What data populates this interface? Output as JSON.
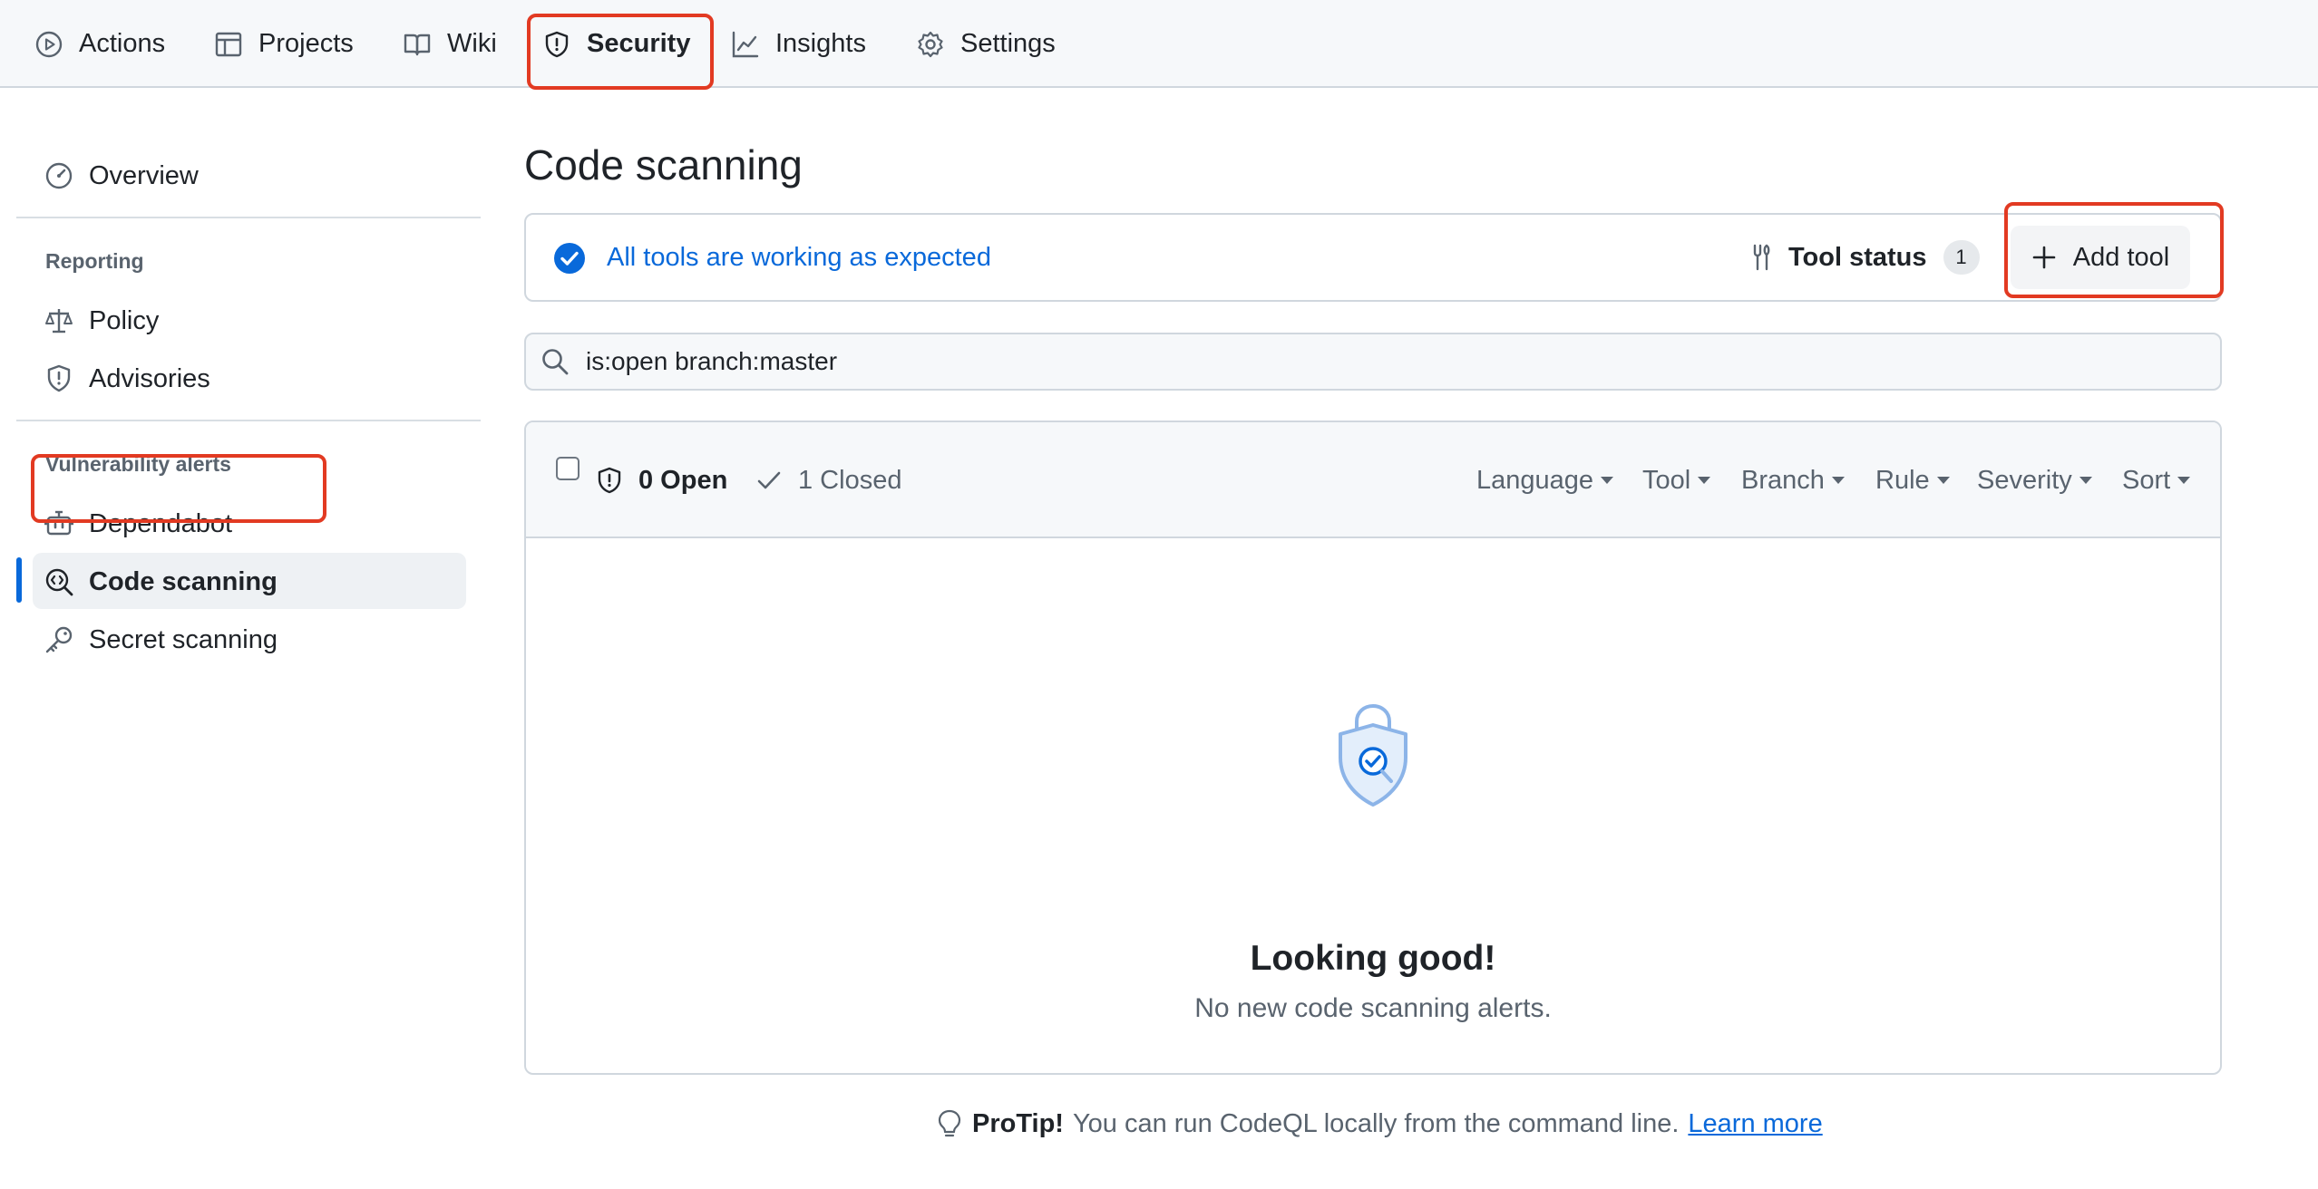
{
  "nav": {
    "items": [
      {
        "label": "Actions",
        "icon": "play-icon"
      },
      {
        "label": "Projects",
        "icon": "table-icon"
      },
      {
        "label": "Wiki",
        "icon": "book-icon"
      },
      {
        "label": "Security",
        "icon": "shield-icon",
        "selected": true
      },
      {
        "label": "Insights",
        "icon": "graph-icon"
      },
      {
        "label": "Settings",
        "icon": "gear-icon"
      }
    ]
  },
  "sidebar": {
    "overview": "Overview",
    "reporting_heading": "Reporting",
    "policy": "Policy",
    "advisories": "Advisories",
    "vuln_heading": "Vulnerability alerts",
    "dependabot": "Dependabot",
    "code_scanning": "Code scanning",
    "secret_scanning": "Secret scanning"
  },
  "main": {
    "title": "Code scanning",
    "status_text": "All tools are working as expected",
    "tool_status_label": "Tool status",
    "tool_status_count": "1",
    "add_tool_label": "Add tool",
    "search_value": "is:open branch:master",
    "open_label": "0 Open",
    "closed_label": "1 Closed",
    "filters": [
      "Language",
      "Tool",
      "Branch",
      "Rule",
      "Severity",
      "Sort"
    ],
    "empty_title": "Looking good!",
    "empty_subtitle": "No new code scanning alerts.",
    "protip_label": "ProTip!",
    "protip_text": "You can run CodeQL locally from the command line.",
    "protip_link": "Learn more"
  },
  "colors": {
    "accent": "#0969da",
    "highlight": "#e23a22",
    "muted": "#59636e"
  }
}
